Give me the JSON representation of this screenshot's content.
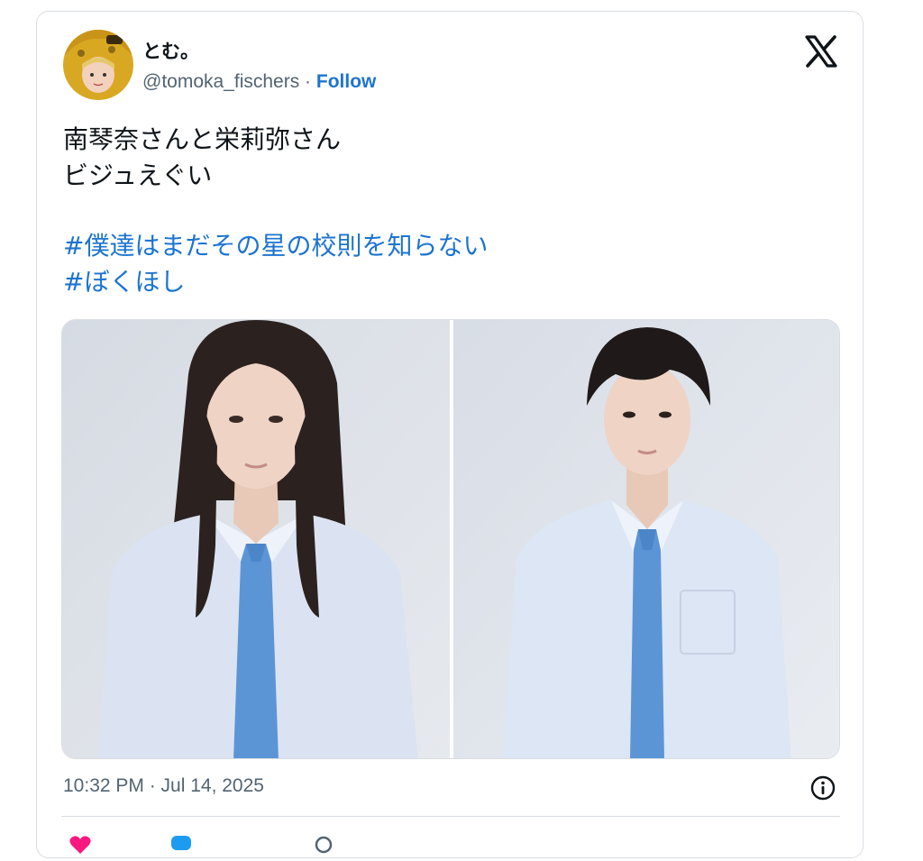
{
  "author": {
    "display_name": "とむ。",
    "handle": "@tomoka_fischers",
    "separator": " · ",
    "follow_label": "Follow"
  },
  "tweet": {
    "text_line1": "南琴奈さんと栄莉弥さん",
    "text_line2": "ビジュえぐい",
    "hashtags": [
      "#僕達はまだその星の校則を知らない",
      "#ぼくほし"
    ]
  },
  "timestamp": "10:32 PM · Jul 14, 2025",
  "icons": {
    "platform": "x-logo-icon",
    "info": "info-icon",
    "like": "heart-icon",
    "reply": "reply-icon",
    "copy": "link-icon"
  },
  "colors": {
    "link": "#1d74d0",
    "text": "#0f1419",
    "muted": "#536471",
    "border": "#d9dde1",
    "tie": "#5b95d6",
    "shirt": "#dde6f4"
  }
}
